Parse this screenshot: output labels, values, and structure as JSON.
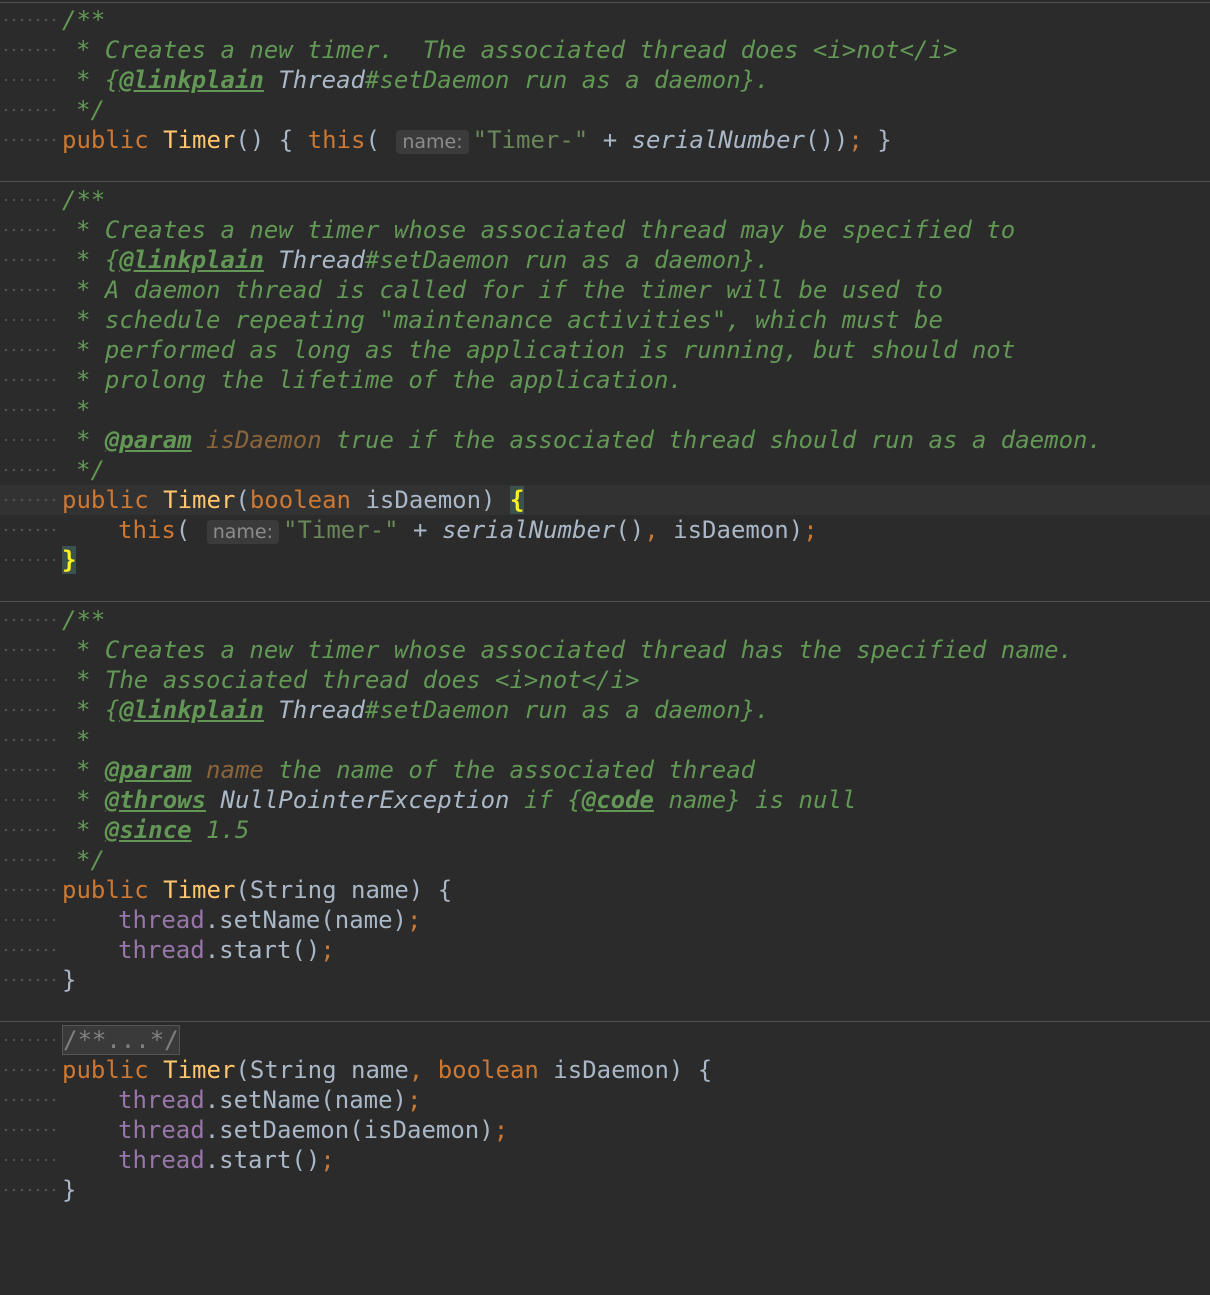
{
  "blocks": {
    "b1": {
      "l1": "/**",
      "l2": "* Creates a new timer.  The associated thread does <i>not</i>",
      "l3a": "* {",
      "l3tag": "@linkplain",
      "l3ref": " Thread",
      "l3b": "#setDaemon run as a daemon}.",
      "l4": "*/",
      "l5_kw": "public",
      "l5_fn": "Timer",
      "l5_p": "() { ",
      "l5_this": "this",
      "l5_open": "( ",
      "l5_hint": "name:",
      "l5_str": "\"Timer-\"",
      "l5_plus": " + ",
      "l5_call": "serialNumber",
      "l5_close": "())",
      "l5_semi": ";",
      "l5_end": " }"
    },
    "b2": {
      "l1": "/**",
      "l2": "* Creates a new timer whose associated thread may be specified to",
      "l3a": "* {",
      "l3tag": "@linkplain",
      "l3ref": " Thread",
      "l3b": "#setDaemon run as a daemon}.",
      "l4": "* A daemon thread is called for if the timer will be used to",
      "l5": "* schedule repeating \"maintenance activities\", which must be",
      "l6": "* performed as long as the application is running, but should not",
      "l7": "* prolong the lifetime of the application.",
      "l8": "*",
      "l9a": "* ",
      "l9tag": "@param",
      "l9p": " isDaemon",
      "l9b": " true if the associated thread should run as a daemon.",
      "l10": "*/",
      "l11_kw": "public",
      "l11_fn": "Timer",
      "l11_p1": "(",
      "l11_kw2": "boolean",
      "l11_p2": " isDaemon) ",
      "l11_br": "{",
      "l12_this": "this",
      "l12_open": "( ",
      "l12_hint": "name:",
      "l12_str": "\"Timer-\"",
      "l12_plus": " + ",
      "l12_call": "serialNumber",
      "l12_p": "()",
      "l12_comma": ",",
      "l12_arg": " isDaemon)",
      "l12_semi": ";",
      "l13_br": "}"
    },
    "b3": {
      "l1": "/**",
      "l2": "* Creates a new timer whose associated thread has the specified name.",
      "l3": "* The associated thread does <i>not</i>",
      "l4a": "* {",
      "l4tag": "@linkplain",
      "l4ref": " Thread",
      "l4b": "#setDaemon run as a daemon}.",
      "l5": "*",
      "l6a": "* ",
      "l6tag": "@param",
      "l6p": " name",
      "l6b": " the name of the associated thread",
      "l7a": "* ",
      "l7tag": "@throws",
      "l7ref": " NullPointerException",
      "l7b": " if {",
      "l7tag2": "@code",
      "l7c": " name} is null",
      "l8a": "* ",
      "l8tag": "@since",
      "l8b": " 1.5",
      "l9": "*/",
      "l10_kw": "public",
      "l10_fn": "Timer",
      "l10_p": "(String name) {",
      "l11_fd": "thread",
      "l11_m": ".setName(name)",
      "l11_semi": ";",
      "l12_fd": "thread",
      "l12_m": ".start()",
      "l12_semi": ";",
      "l13": "}"
    },
    "b4": {
      "l1": "/**...*/",
      "l2_kw": "public",
      "l2_fn": "Timer",
      "l2_p1": "(String name",
      "l2_comma": ",",
      "l2_kw2": " boolean",
      "l2_p2": " isDaemon) {",
      "l3_fd": "thread",
      "l3_m": ".setName(name)",
      "l3_semi": ";",
      "l4_fd": "thread",
      "l4_m": ".setDaemon(isDaemon)",
      "l4_semi": ";",
      "l5_fd": "thread",
      "l5_m": ".start()",
      "l5_semi": ";",
      "l6": "}"
    }
  },
  "colors": {
    "background": "#2b2b2b",
    "comment": "#629755",
    "keyword": "#cc7832",
    "method_name": "#ffc66d",
    "string": "#6a8759",
    "field": "#9876aa",
    "text": "#a9b7c6",
    "param_name": "#8a653b",
    "matched_brace": "#ffef28"
  }
}
